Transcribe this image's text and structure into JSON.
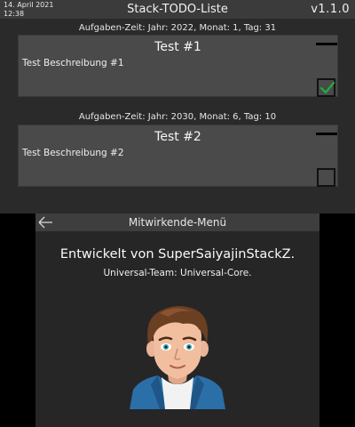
{
  "top": {
    "date": "14. April 2021",
    "time": "12:38",
    "app_title": "Stack-TODO-Liste",
    "version": "v1.1.0"
  },
  "tasks": [
    {
      "meta": "Aufgaben-Zeit: Jahr: 2022, Monat: 1, Tag: 31",
      "title": "Test #1",
      "description": "Test Beschreibung #1",
      "done": true
    },
    {
      "meta": "Aufgaben-Zeit: Jahr: 2030, Monat: 6, Tag: 10",
      "title": "Test #2",
      "description": "Test Beschreibung #2",
      "done": false
    }
  ],
  "bottom": {
    "back_icon": "arrow-left-icon",
    "menu_title": "Mitwirkende-Menü",
    "credit_main": "Entwickelt von SuperSaiyajinStackZ.",
    "credit_sub": "Universal-Team: Universal-Core."
  },
  "colors": {
    "check_green": "#1fb03a",
    "hair": "#6b3f22",
    "jacket": "#2a6fa8"
  }
}
